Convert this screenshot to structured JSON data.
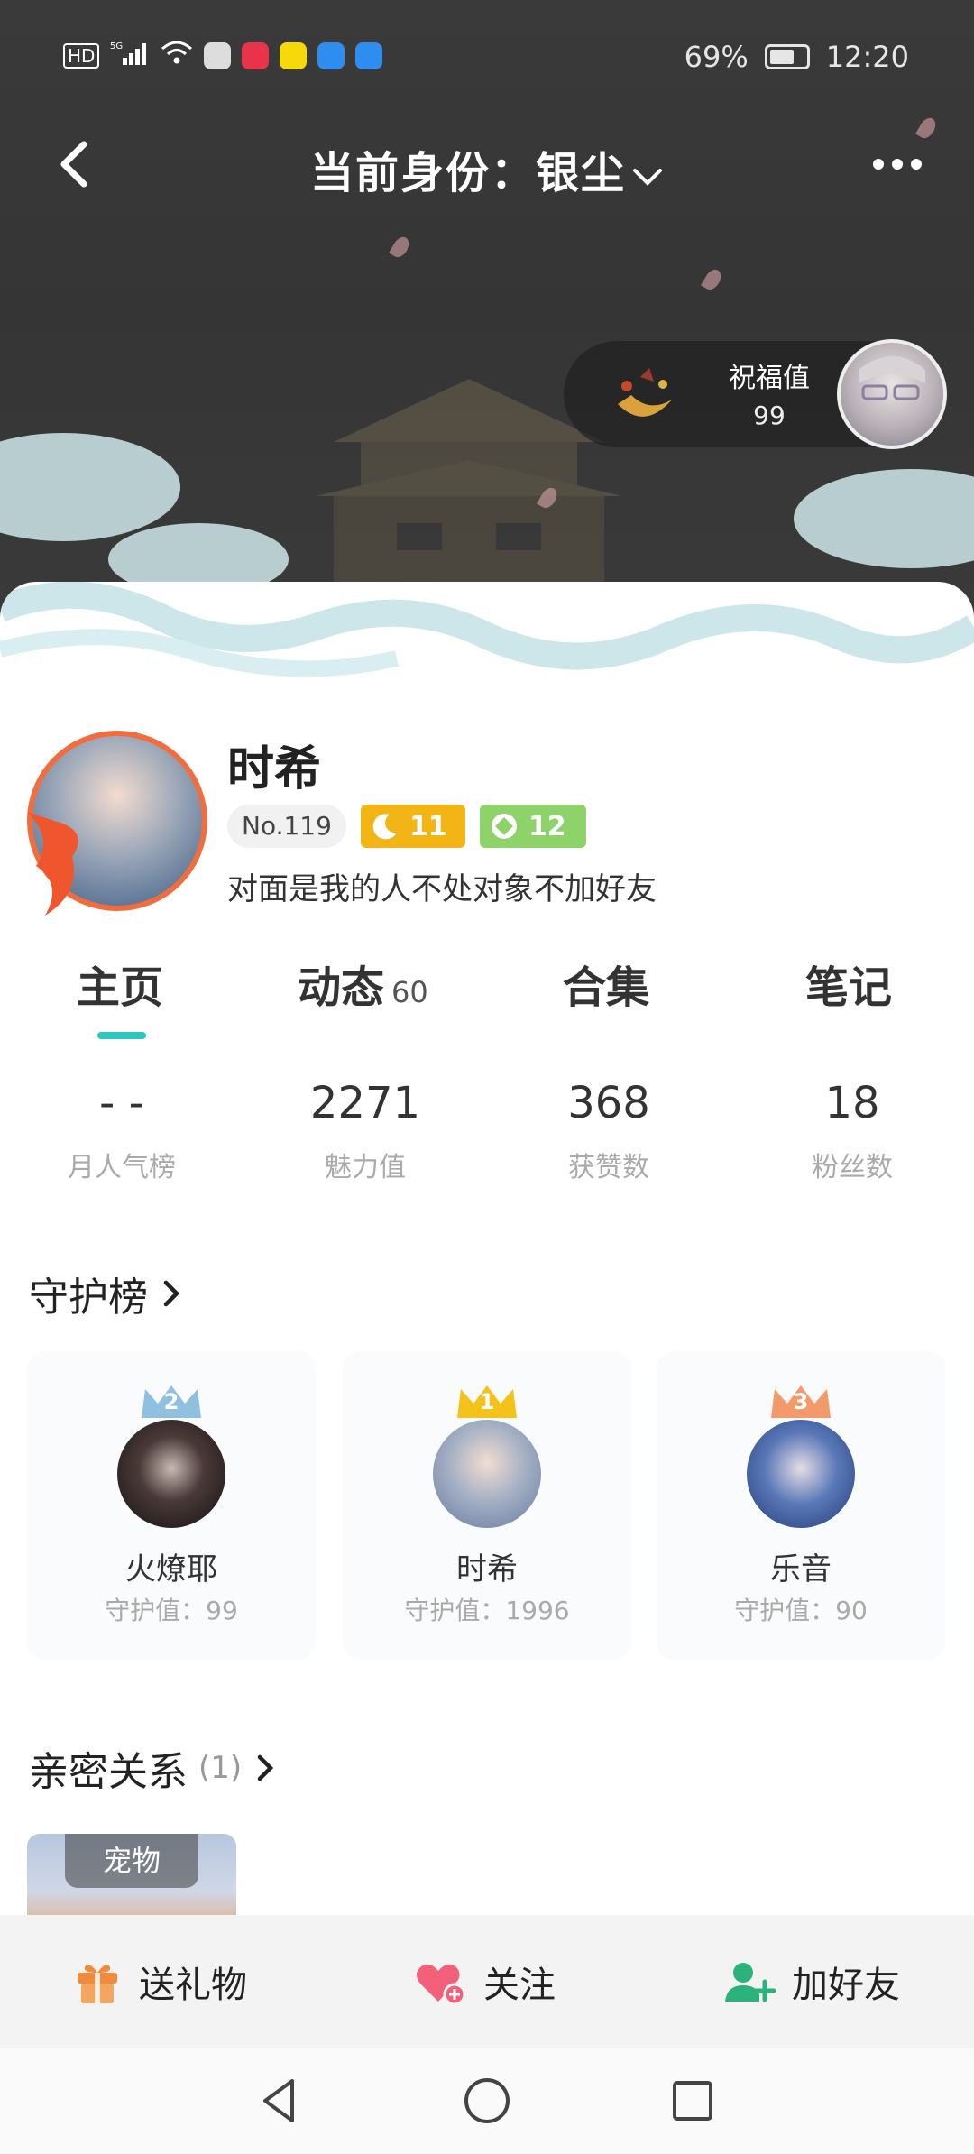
{
  "status_bar": {
    "left_text": "HD",
    "signal_text": "5G",
    "battery": "69%",
    "time": "12:20"
  },
  "nav": {
    "title": "当前身份：银尘",
    "back_icon": "chevron-left-icon",
    "more_icon": "more-dots-icon"
  },
  "blessing": {
    "label": "祝福值",
    "value": "99"
  },
  "profile": {
    "name": "时希",
    "number_badge": "No.119",
    "moon_level": "11",
    "gem_level": "12",
    "bio": "对面是我的人不处对象不加好友"
  },
  "tabs": [
    {
      "label": "主页",
      "count": ""
    },
    {
      "label": "动态",
      "count": "60"
    },
    {
      "label": "合集",
      "count": ""
    },
    {
      "label": "笔记",
      "count": ""
    }
  ],
  "stats": [
    {
      "value": "- -",
      "label": "月人气榜"
    },
    {
      "value": "2271",
      "label": "魅力值"
    },
    {
      "value": "368",
      "label": "获赞数"
    },
    {
      "value": "18",
      "label": "粉丝数"
    }
  ],
  "guard": {
    "title": "守护榜",
    "members": [
      {
        "rank": "2",
        "name": "火燎耶",
        "value": "守护值：99",
        "crown_color": "#8fc0e0"
      },
      {
        "rank": "1",
        "name": "时希",
        "value": "守护值：1996",
        "crown_color": "#f5c21a"
      },
      {
        "rank": "3",
        "name": "乐音",
        "value": "守护值：90",
        "crown_color": "#f29a6a"
      }
    ]
  },
  "intimate": {
    "title": "亲密关系",
    "count": "(1)",
    "card_label": "宠物"
  },
  "actions": [
    {
      "label": "送礼物",
      "icon": "gift-icon"
    },
    {
      "label": "关注",
      "icon": "heart-plus-icon"
    },
    {
      "label": "加好友",
      "icon": "add-friend-icon"
    }
  ],
  "colors": {
    "accent": "#2ec7c0",
    "banner": "#3a3a3a",
    "gift": "#f08a3c",
    "heart": "#f2607a",
    "friend": "#2ab37a"
  }
}
